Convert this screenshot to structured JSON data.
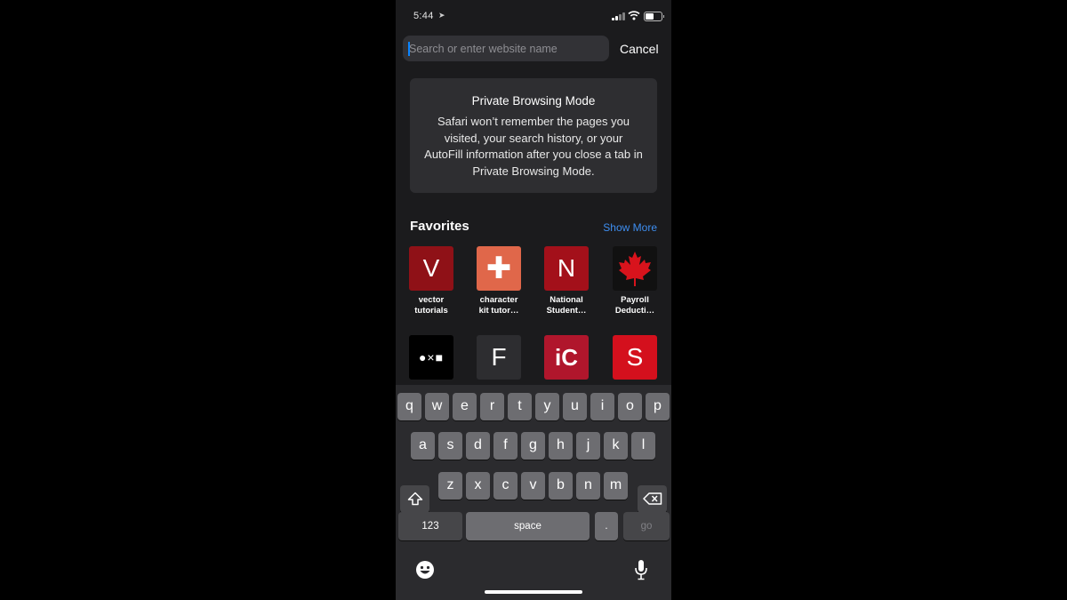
{
  "status_bar": {
    "time": "5:44"
  },
  "search": {
    "placeholder": "Search or enter website name",
    "cancel_label": "Cancel"
  },
  "private_mode": {
    "title": "Private Browsing Mode",
    "message": "Safari won’t remember the pages you visited, your search history, or your AutoFill information after you close a tab in Private Browsing Mode."
  },
  "favorites": {
    "title": "Favorites",
    "show_more_label": "Show More",
    "items": [
      {
        "glyph": "V",
        "label": "vector\ntutorials",
        "color": "#8f1117"
      },
      {
        "glyph": "✚",
        "label": "character\nkit tutor…",
        "color": "#e0674a"
      },
      {
        "glyph": "N",
        "label": "National\nStudent…",
        "color": "#a3101a"
      },
      {
        "glyph": "",
        "label": "Payroll\nDeducti…",
        "color": "#111111",
        "icon": "maple-leaf-icon"
      },
      {
        "glyph": "●×■",
        "label": "",
        "color": "#000000"
      },
      {
        "glyph": "F",
        "label": "",
        "color": "#2d2d30"
      },
      {
        "glyph": "iC",
        "label": "",
        "color": "#b0162c"
      },
      {
        "glyph": "S",
        "label": "",
        "color": "#d4101d"
      }
    ]
  },
  "keyboard": {
    "row1": [
      "q",
      "w",
      "e",
      "r",
      "t",
      "y",
      "u",
      "i",
      "o",
      "p"
    ],
    "row2": [
      "a",
      "s",
      "d",
      "f",
      "g",
      "h",
      "j",
      "k",
      "l"
    ],
    "row3": [
      "z",
      "x",
      "c",
      "v",
      "b",
      "n",
      "m"
    ],
    "numbers_label": "123",
    "space_label": "space",
    "period_label": ".",
    "go_label": "go"
  }
}
